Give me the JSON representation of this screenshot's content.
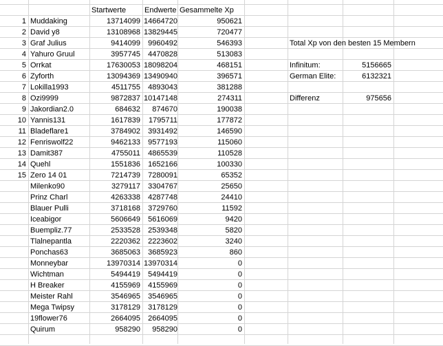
{
  "headers": {
    "start": "Startwerte",
    "end": "Endwerte",
    "xp": "Gesammelte Xp"
  },
  "players": [
    {
      "rank": "1",
      "name": "Muddaking",
      "start": "13714099",
      "end": "14664720",
      "xp": "950621"
    },
    {
      "rank": "2",
      "name": "David y8",
      "start": "13108968",
      "end": "13829445",
      "xp": "720477"
    },
    {
      "rank": "3",
      "name": "Graf Julius",
      "start": "9414099",
      "end": "9960492",
      "xp": "546393"
    },
    {
      "rank": "4",
      "name": "Yahuro Gruul",
      "start": "3957745",
      "end": "4470828",
      "xp": "513083"
    },
    {
      "rank": "5",
      "name": "Orrkat",
      "start": "17630053",
      "end": "18098204",
      "xp": "468151"
    },
    {
      "rank": "6",
      "name": "Zyforth",
      "start": "13094369",
      "end": "13490940",
      "xp": "396571"
    },
    {
      "rank": "7",
      "name": "Lokilla1993",
      "start": "4511755",
      "end": "4893043",
      "xp": "381288"
    },
    {
      "rank": "8",
      "name": "Ozi9999",
      "start": "9872837",
      "end": "10147148",
      "xp": "274311"
    },
    {
      "rank": "9",
      "name": "Jakordian2.0",
      "start": "684632",
      "end": "874670",
      "xp": "190038"
    },
    {
      "rank": "10",
      "name": "Yannis131",
      "start": "1617839",
      "end": "1795711",
      "xp": "177872"
    },
    {
      "rank": "11",
      "name": "Bladeflare1",
      "start": "3784902",
      "end": "3931492",
      "xp": "146590"
    },
    {
      "rank": "12",
      "name": "Fenriswolf22",
      "start": "9462133",
      "end": "9577193",
      "xp": "115060"
    },
    {
      "rank": "13",
      "name": "Damit387",
      "start": "4755011",
      "end": "4865539",
      "xp": "110528"
    },
    {
      "rank": "14",
      "name": "Quehl",
      "start": "1551836",
      "end": "1652166",
      "xp": "100330"
    },
    {
      "rank": "15",
      "name": "Zero 14 01",
      "start": "7214739",
      "end": "7280091",
      "xp": "65352"
    },
    {
      "rank": "",
      "name": "Milenko90",
      "start": "3279117",
      "end": "3304767",
      "xp": "25650"
    },
    {
      "rank": "",
      "name": "Prinz Charl",
      "start": "4263338",
      "end": "4287748",
      "xp": "24410"
    },
    {
      "rank": "",
      "name": "Blauer Pulli",
      "start": "3718168",
      "end": "3729760",
      "xp": "11592"
    },
    {
      "rank": "",
      "name": "Iceabigor",
      "start": "5606649",
      "end": "5616069",
      "xp": "9420"
    },
    {
      "rank": "",
      "name": "Buempliz.77",
      "start": "2533528",
      "end": "2539348",
      "xp": "5820"
    },
    {
      "rank": "",
      "name": "Tlalnepantla",
      "start": "2220362",
      "end": "2223602",
      "xp": "3240"
    },
    {
      "rank": "",
      "name": "Ponchas63",
      "start": "3685063",
      "end": "3685923",
      "xp": "860"
    },
    {
      "rank": "",
      "name": "Monneybar",
      "start": "13970314",
      "end": "13970314",
      "xp": "0"
    },
    {
      "rank": "",
      "name": "Wichtman",
      "start": "5494419",
      "end": "5494419",
      "xp": "0"
    },
    {
      "rank": "",
      "name": "H Breaker",
      "start": "4155969",
      "end": "4155969",
      "xp": "0"
    },
    {
      "rank": "",
      "name": "Meister Rahl",
      "start": "3546965",
      "end": "3546965",
      "xp": "0"
    },
    {
      "rank": "",
      "name": "Mega Twipsy",
      "start": "3178129",
      "end": "3178129",
      "xp": "0"
    },
    {
      "rank": "",
      "name": "19flower76",
      "start": "2664095",
      "end": "2664095",
      "xp": "0"
    },
    {
      "rank": "",
      "name": "Quirum",
      "start": "958290",
      "end": "958290",
      "xp": "0"
    }
  ],
  "summary": {
    "title": "Total Xp von den besten 15 Membern",
    "infinitum_label": "Infinitum:",
    "infinitum_value": "5156665",
    "german_elite_label": "German Elite:",
    "german_elite_value": "6132321",
    "differenz_label": "Differenz",
    "differenz_value": "975656"
  }
}
